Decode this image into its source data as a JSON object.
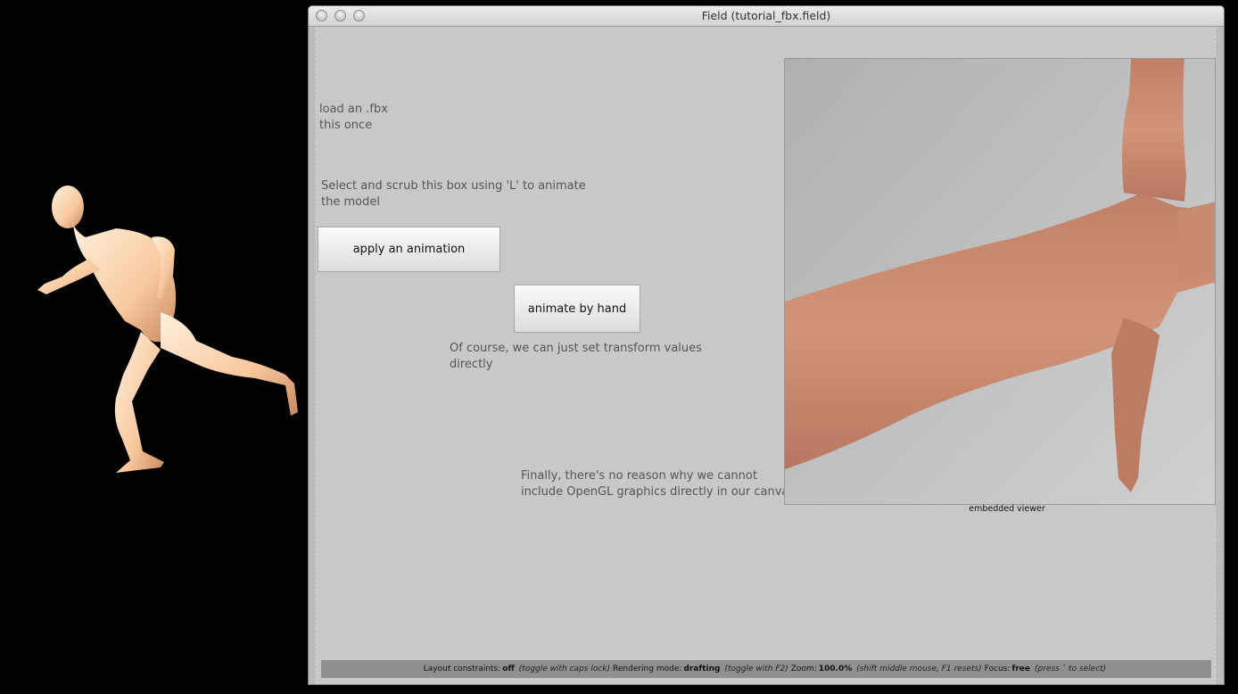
{
  "window": {
    "title": "Field (tutorial_fbx.field)"
  },
  "canvas": {
    "load_text": "load an .fbx\nthis once",
    "scrub_text": "Select and scrub this box using 'L' to animate\nthe model",
    "apply_button": "apply an animation",
    "animate_button": "animate by hand",
    "transform_text": "Of course, we can just set transform values\ndirectly",
    "opengl_text": "Finally, there's no reason why we cannot\ninclude OpenGL graphics directly in our canvas",
    "viewer_label": "embedded viewer"
  },
  "status": {
    "layout_label": "Layout constraints:",
    "layout_value": "off",
    "layout_hint": "(toggle with caps lock)",
    "render_label": "Rendering mode:",
    "render_value": "drafting",
    "render_hint": "(toggle with F2)",
    "zoom_label": "Zoom:",
    "zoom_value": "100.0%",
    "zoom_hint": "(shift middle mouse, F1 resets)",
    "focus_label": "Focus:",
    "focus_value": "free",
    "focus_hint": "(press ` to select)"
  },
  "colors": {
    "canvas_bg": "#c8c8c8",
    "figure_left": "#f8c8a0",
    "figure_viewer": "#c8846a"
  }
}
